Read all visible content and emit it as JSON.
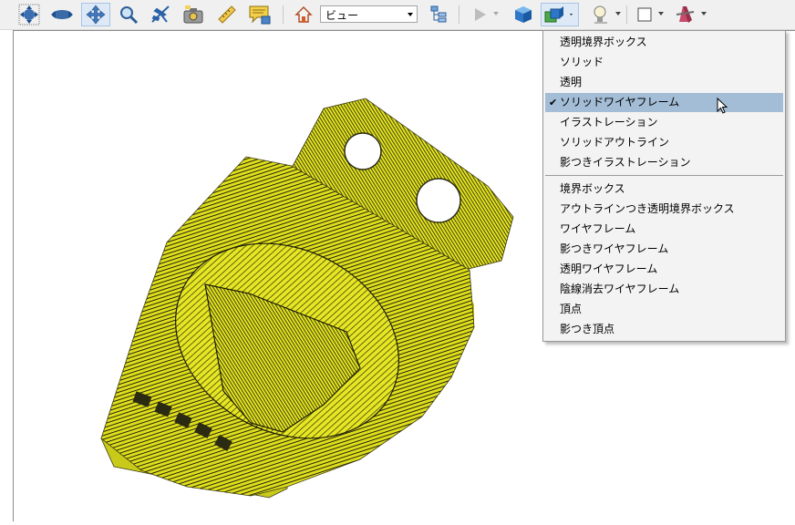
{
  "toolbar": {
    "tools": [
      {
        "name": "rotate-tool",
        "icon": "rotate-icon"
      },
      {
        "name": "spin-tool",
        "icon": "spin-icon"
      },
      {
        "name": "pan-tool",
        "icon": "pan-icon",
        "active": true
      },
      {
        "name": "zoom-tool",
        "icon": "zoom-icon"
      },
      {
        "name": "fly-tool",
        "icon": "airplane-icon"
      },
      {
        "name": "camera-tool",
        "icon": "camera-icon"
      },
      {
        "name": "measure-tool",
        "icon": "ruler-icon"
      },
      {
        "name": "comment-tool",
        "icon": "comment-icon"
      },
      {
        "name": "home-view",
        "icon": "home-icon"
      },
      {
        "name": "model-tree-toggle",
        "icon": "model-tree-icon"
      },
      {
        "name": "play-animation",
        "icon": "play-icon"
      },
      {
        "name": "render-mode-solid",
        "icon": "cube-icon"
      },
      {
        "name": "render-mode-dropdown",
        "icon": "render-mode-icon"
      },
      {
        "name": "lighting-dropdown",
        "icon": "lightbulb-icon"
      },
      {
        "name": "background-color-dropdown",
        "icon": "background-swatch-icon"
      },
      {
        "name": "cross-section-dropdown",
        "icon": "cross-section-icon"
      }
    ],
    "view_select": {
      "value": "ビュー"
    }
  },
  "colors": {
    "model": "#e3e31e",
    "model_dark": "#1c1c10",
    "menu_highlight": "#a4bdd6"
  },
  "render_menu": {
    "group1": [
      {
        "label": "透明境界ボックス"
      },
      {
        "label": "ソリッド"
      },
      {
        "label": "透明"
      },
      {
        "label": "ソリッドワイヤフレーム",
        "selected": true,
        "checked": true
      },
      {
        "label": "イラストレーション"
      },
      {
        "label": "ソリッドアウトライン"
      },
      {
        "label": "影つきイラストレーション"
      }
    ],
    "group2": [
      {
        "label": "境界ボックス"
      },
      {
        "label": "アウトラインつき透明境界ボックス"
      },
      {
        "label": "ワイヤフレーム"
      },
      {
        "label": "影つきワイヤフレーム"
      },
      {
        "label": "透明ワイヤフレーム"
      },
      {
        "label": "陰線消去ワイヤフレーム"
      },
      {
        "label": "頂点"
      },
      {
        "label": "影つき頂点"
      }
    ],
    "check_mark": "✔"
  }
}
